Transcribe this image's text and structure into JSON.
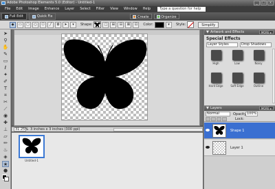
{
  "titlebar": {
    "title": "Adobe Photoshop Elements 5.0 (Editor) - Untitled-1",
    "min": "_",
    "max": "□",
    "close": "x"
  },
  "menu": {
    "items": [
      "File",
      "Edit",
      "Image",
      "Enhance",
      "Layer",
      "Select",
      "Filter",
      "View",
      "Window",
      "Help"
    ],
    "help_placeholder": "Type a question for help"
  },
  "modebar": {
    "full_edit": "Full Edit",
    "quick_fix": "Quick Fix",
    "create": "Create",
    "organize": "Organize"
  },
  "options": {
    "shape_label": "Shape:",
    "color_label": "Color:",
    "style_label": "Style:",
    "simplify_label": "Simplify",
    "color": "#000000"
  },
  "status": {
    "zoom": "31.25%",
    "doc_size": "3 inches x 3 inches (300 ppi)"
  },
  "project_bin": {
    "item_label": "Untitled-1"
  },
  "artwork_panel": {
    "header": "Artwork and Effects",
    "more": "MORE ▸",
    "title": "Special Effects",
    "category": "Layer Styles",
    "subcategory": "Drop Shadows",
    "effects": [
      "High",
      "Low",
      "Noisy",
      "Hard Edge",
      "Soft Edge",
      "Outline"
    ]
  },
  "layers_panel": {
    "header": "Layers",
    "more": "MORE ▸",
    "blend_mode": "Normal",
    "opacity_label": "Opacity:",
    "opacity": "100%",
    "lock_label": "Lock:",
    "layers": [
      {
        "name": "Shape 1"
      },
      {
        "name": "Layer 1"
      }
    ]
  }
}
